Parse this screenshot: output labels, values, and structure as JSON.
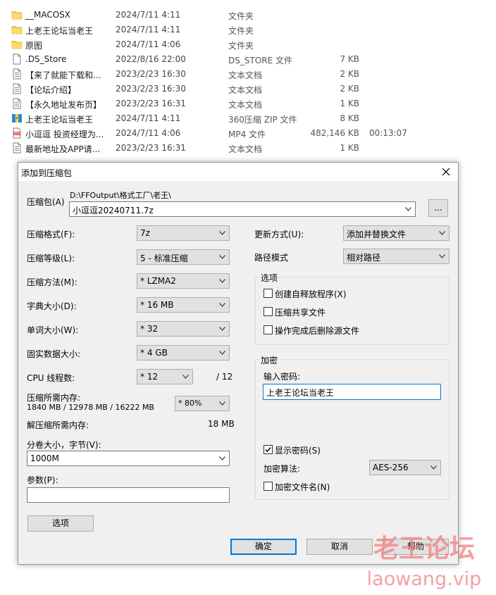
{
  "files": [
    {
      "name": "__MACOSX",
      "date": "2024/7/11 4:11",
      "type": "文件夹",
      "size": "",
      "duration": "",
      "icon": "folder-icon"
    },
    {
      "name": "上老王论坛当老王",
      "date": "2024/7/11 4:11",
      "type": "文件夹",
      "size": "",
      "duration": "",
      "icon": "folder-icon"
    },
    {
      "name": "原图",
      "date": "2024/7/11 4:06",
      "type": "文件夹",
      "size": "",
      "duration": "",
      "icon": "folder-icon"
    },
    {
      "name": ".DS_Store",
      "date": "2022/8/16 22:00",
      "type": "DS_STORE 文件",
      "size": "7 KB",
      "duration": "",
      "icon": "file-icon"
    },
    {
      "name": "【来了就能下载和...",
      "date": "2023/2/23 16:30",
      "type": "文本文档",
      "size": "2 KB",
      "duration": "",
      "icon": "text-file-icon"
    },
    {
      "name": "【论坛介绍】",
      "date": "2023/2/23 16:30",
      "type": "文本文档",
      "size": "2 KB",
      "duration": "",
      "icon": "text-file-icon"
    },
    {
      "name": "【永久地址发布页】",
      "date": "2023/2/23 16:31",
      "type": "文本文档",
      "size": "1 KB",
      "duration": "",
      "icon": "text-file-icon"
    },
    {
      "name": "上老王论坛当老王",
      "date": "2024/7/11 4:11",
      "type": "360压缩 ZIP 文件",
      "size": "8 KB",
      "duration": "",
      "icon": "zip-file-icon"
    },
    {
      "name": "小逗逗 投资经理为...",
      "date": "2024/7/11 4:06",
      "type": "MP4 文件",
      "size": "482,146 KB",
      "duration": "00:13:07",
      "icon": "mp4-file-icon"
    },
    {
      "name": "最新地址及APP请...",
      "date": "2023/2/23 16:31",
      "type": "文本文档",
      "size": "1 KB",
      "duration": "",
      "icon": "text-file-icon"
    }
  ],
  "dialog": {
    "title": "添加到压缩包",
    "archive_label": "压缩包(A)",
    "archive_path": "D:\\FFOutput\\格式工厂\\老王\\",
    "archive_name": "小逗逗20240711.7z",
    "browse_label": "...",
    "format_label": "压缩格式(F):",
    "format_value": "7z",
    "level_label": "压缩等级(L):",
    "level_value": "5 - 标准压缩",
    "method_label": "压缩方法(M):",
    "method_value": "* LZMA2",
    "dict_label": "字典大小(D):",
    "dict_value": "* 16 MB",
    "word_label": "单词大小(W):",
    "word_value": "* 32",
    "solid_label": "固实数据大小:",
    "solid_value": "* 4 GB",
    "threads_label": "CPU 线程数:",
    "threads_value": "* 12",
    "threads_total": "/ 12",
    "mem_comp_label": "压缩所需内存:",
    "mem_comp_value": "1840 MB / 12978 MB / 16222 MB",
    "mem_percent": "* 80%",
    "mem_decomp_label": "解压缩所需内存:",
    "mem_decomp_value": "18 MB",
    "split_label": "分卷大小，字节(V):",
    "split_value": "1000M",
    "params_label": "参数(P):",
    "params_value": "",
    "options_button": "选项",
    "update_label": "更新方式(U):",
    "update_value": "添加并替换文件",
    "path_label": "路径模式",
    "path_value": "相对路径",
    "options_group": "选项",
    "opt_sfx": "创建自释放程序(X)",
    "opt_shared": "压缩共享文件",
    "opt_delete": "操作完成后删除源文件",
    "encrypt_group": "加密",
    "password_label": "输入密码:",
    "password_value": "上老王论坛当老王",
    "show_password": "显示密码(S)",
    "enc_method_label": "加密算法:",
    "enc_method_value": "AES-256",
    "encrypt_names": "加密文件名(N)",
    "ok_button": "确定",
    "cancel_button": "取消",
    "help_button": "帮助"
  },
  "watermark": {
    "line1": "老王论坛",
    "line2": "laowang.vip"
  },
  "colors": {
    "folder": "#f6cf57",
    "accent": "#0078d7",
    "watermark": "#f08080"
  }
}
